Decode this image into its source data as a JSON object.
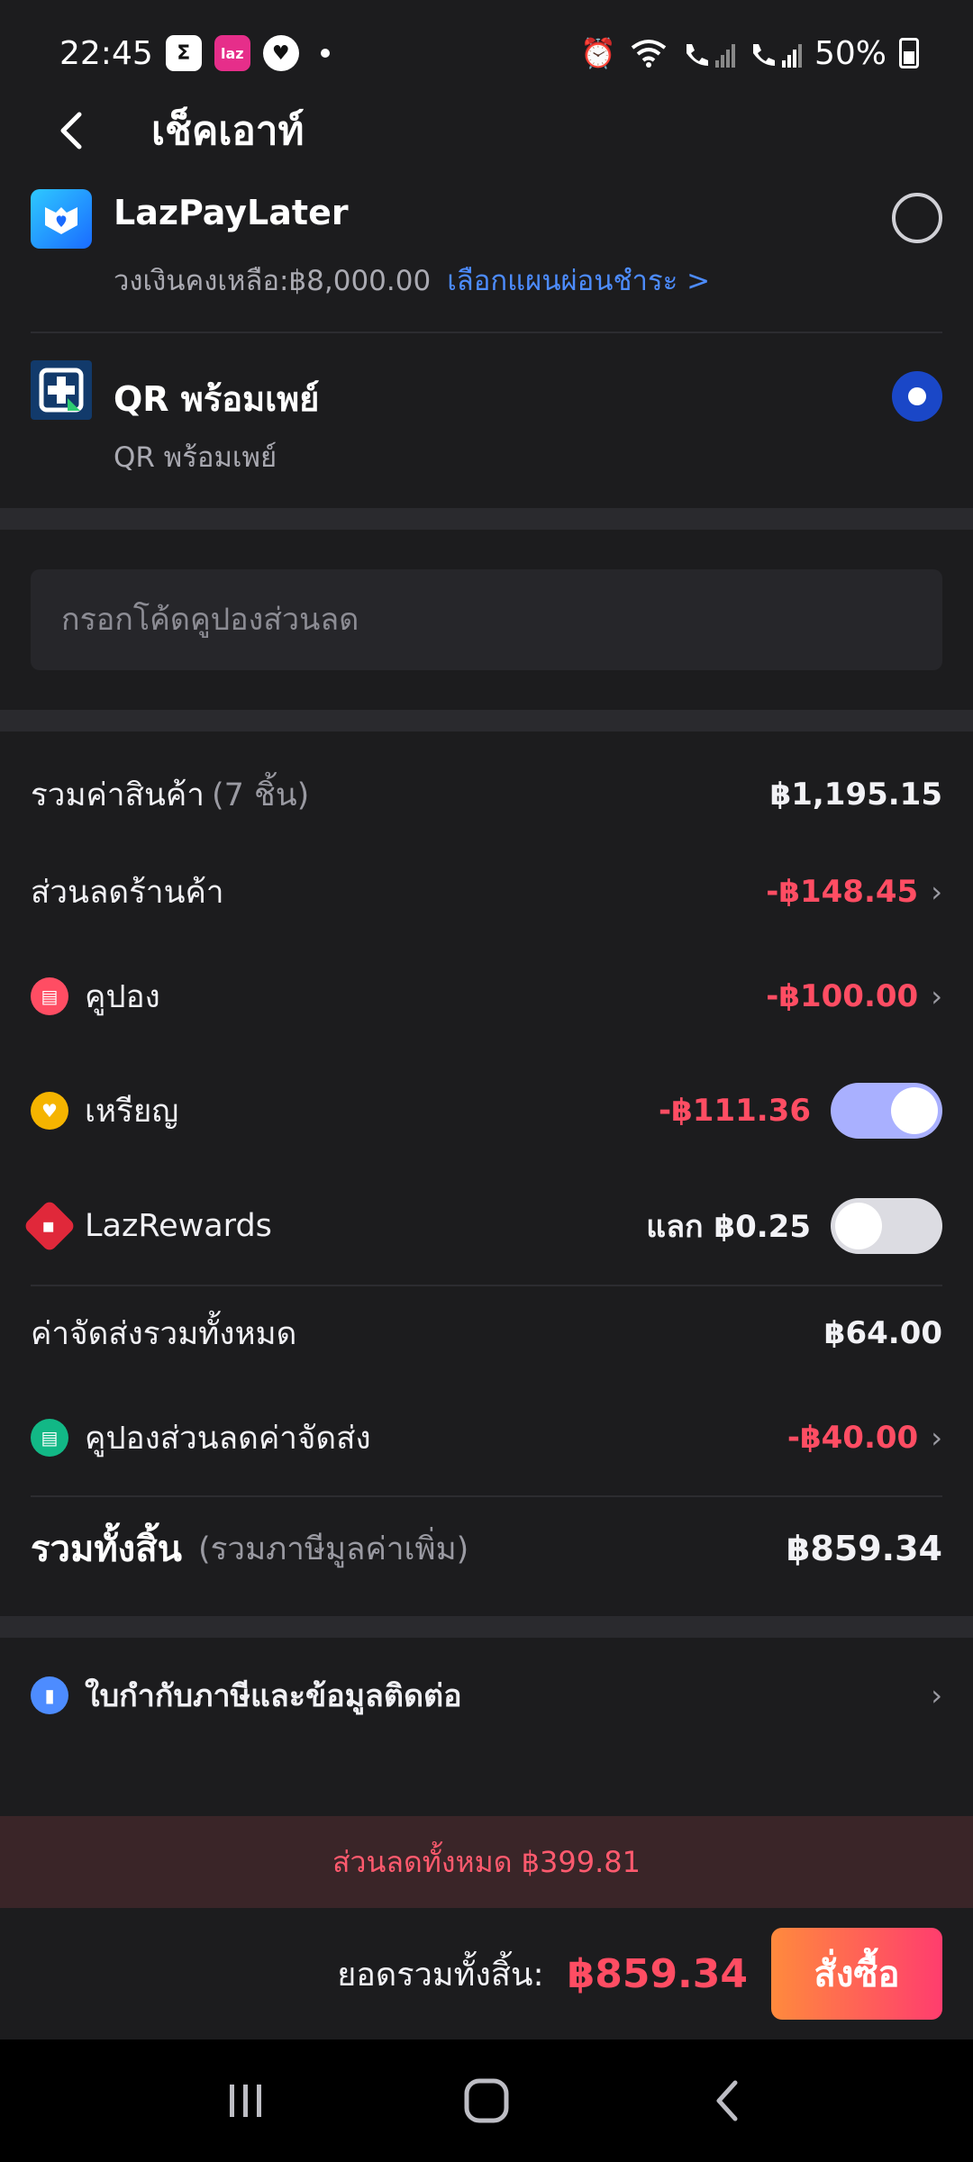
{
  "status_bar": {
    "time": "22:45",
    "battery": "50%",
    "app_badge_laz": "laz"
  },
  "header": {
    "title": "เช็คเอาท์"
  },
  "payment_methods": [
    {
      "title": "LazPayLater",
      "credit_text": "วงเงินคงเหลือ:฿8,000.00",
      "plan_link": "เลือกแผนผ่อนชำระ >",
      "selected": false
    },
    {
      "title": "QR พร้อมเพย์",
      "subtitle": "QR พร้อมเพย์",
      "selected": true
    }
  ],
  "voucher": {
    "placeholder": "กรอกโค้ดคูปองส่วนลด"
  },
  "summary": {
    "subtotal_label": "รวมค่าสินค้า",
    "subtotal_count": "(7 ชิ้น)",
    "subtotal_value": "฿1,195.15",
    "store_discount_label": "ส่วนลดร้านค้า",
    "store_discount_value": "-฿148.45",
    "coupon_label": "คูปอง",
    "coupon_value": "-฿100.00",
    "coins_label": "เหรียญ",
    "coins_value": "-฿111.36",
    "coins_enabled": true,
    "lazrewards_label": "LazRewards",
    "lazrewards_value": "แลก ฿0.25",
    "lazrewards_enabled": false,
    "shipping_label": "ค่าจัดส่งรวมทั้งหมด",
    "shipping_value": "฿64.00",
    "shipping_coupon_label": "คูปองส่วนลดค่าจัดส่ง",
    "shipping_coupon_value": "-฿40.00",
    "total_label": "รวมทั้งสิ้น",
    "total_note": "(รวมภาษีมูลค่าเพิ่ม)",
    "total_value": "฿859.34"
  },
  "invoice": {
    "label": "ใบกำกับภาษีและข้อมูลติดต่อ"
  },
  "banner": {
    "text": "ส่วนลดทั้งหมด ฿399.81"
  },
  "checkout": {
    "grand_total_label": "ยอดรวมทั้งสิ้น:",
    "grand_total_value": "฿859.34",
    "order_button": "สั่งซื้อ"
  },
  "colors": {
    "background": "#1c1c1e",
    "accent_link": "#4d8cff",
    "negative": "#ff4d63",
    "radio_selected": "#1a47c7",
    "toggle_on": "#a9b0ff",
    "coupon_icon": "#ff4d63",
    "coins_icon": "#f5b400",
    "lazrewards_icon": "#e0283a",
    "shipping_coupon_icon": "#12b886",
    "invoice_icon": "#4d8cff"
  },
  "icons": {
    "back": "chevron-left-icon",
    "lazpaylater": "lazpaylater-logo-icon",
    "promptpay": "promptpay-qr-icon",
    "coupon": "ticket-icon",
    "coins": "coin-icon",
    "lazrewards": "lazrewards-icon",
    "shipping_coupon": "shipping-ticket-icon",
    "invoice": "receipt-icon"
  }
}
